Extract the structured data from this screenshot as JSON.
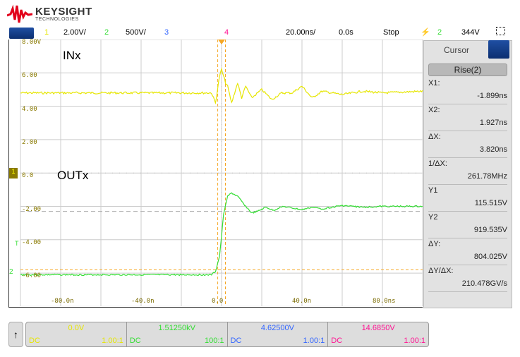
{
  "brand": {
    "name": "KEYSIGHT",
    "sub": "TECHNOLOGIES",
    "color": "#e2001a"
  },
  "topbar": {
    "ch1": "1",
    "ch1_scale": "2.00V/",
    "ch2": "2",
    "ch2_scale": "500V/",
    "ch3": "3",
    "ch4": "4",
    "timebase": "20.00ns/",
    "delay": "0.0s",
    "run_state": "Stop",
    "trig_source": "2",
    "trig_level": "344V"
  },
  "colors": {
    "ch1": "#e6e600",
    "ch2": "#33dd33",
    "ch3": "#3366ff",
    "ch4": "#ff1493",
    "cursor": "#f5a623"
  },
  "plot": {
    "y_labels": [
      "8.00V",
      "6.00",
      "4.00",
      "2.00",
      "0.0",
      "-2.00",
      "-4.00",
      "-6.00"
    ],
    "x_labels": [
      "-80.0n",
      "-40.0n",
      "0.0",
      "40.0n",
      "80.0ns"
    ],
    "trace_labels": {
      "in": "INx",
      "out": "OUTx"
    },
    "markers": {
      "trigger": "T",
      "ch1": "1",
      "ch2": "2"
    },
    "cursors": {
      "x1_ns": -1.899,
      "x2_ns": 1.927,
      "y1_div": -2.3,
      "y2_div": -5.8
    },
    "ch1_trace": {
      "x_ns": [
        -100,
        -5,
        -3,
        -1,
        0,
        1,
        2,
        3,
        5,
        8,
        10,
        12,
        15,
        20,
        25,
        30,
        35,
        40,
        45,
        50,
        60,
        70,
        80,
        100
      ],
      "y_div": [
        2.4,
        2.4,
        2.1,
        2.9,
        3.1,
        2.9,
        2.7,
        2.6,
        2.1,
        2.7,
        2.25,
        2.6,
        2.25,
        2.5,
        2.2,
        2.4,
        2.4,
        2.6,
        2.25,
        2.45,
        2.35,
        2.45,
        2.4,
        2.45
      ]
    },
    "ch2_trace": {
      "x_ns": [
        -100,
        -5,
        -3,
        -1,
        0,
        1,
        2,
        3,
        5,
        8,
        12,
        15,
        18,
        22,
        26,
        30,
        35,
        40,
        45,
        50,
        60,
        70,
        80,
        100
      ],
      "y_div": [
        -6.1,
        -6.1,
        -5.9,
        -5.0,
        -3.8,
        -2.5,
        -1.9,
        -1.4,
        -1.2,
        -1.4,
        -2.0,
        -2.4,
        -2.3,
        -2.05,
        -2.25,
        -2.0,
        -2.1,
        -2.2,
        -2.05,
        -2.15,
        -1.95,
        -2.05,
        -2.0,
        -2.0
      ]
    }
  },
  "cursor_panel": {
    "title": "Cursor",
    "mode": "Rise(2)",
    "rows": [
      {
        "k": "X1:",
        "v": "-1.899ns"
      },
      {
        "k": "X2:",
        "v": "1.927ns"
      },
      {
        "k": "ΔX:",
        "v": "3.820ns"
      },
      {
        "k": "1/ΔX:",
        "v": "261.78MHz"
      },
      {
        "k": "Y1",
        "v": "115.515V"
      },
      {
        "k": "Y2",
        "v": "919.535V"
      },
      {
        "k": "ΔY:",
        "v": "804.025V"
      },
      {
        "k": "ΔY/ΔX:",
        "v": "210.478GV/s"
      }
    ]
  },
  "channels": [
    {
      "offset": "0.0V",
      "coupling": "DC",
      "probe": "1.00:1"
    },
    {
      "offset": "1.51250kV",
      "coupling": "DC",
      "probe": "100:1"
    },
    {
      "offset": "4.62500V",
      "coupling": "DC",
      "probe": "1.00:1"
    },
    {
      "offset": "14.6850V",
      "coupling": "DC",
      "probe": "1.00:1"
    }
  ]
}
